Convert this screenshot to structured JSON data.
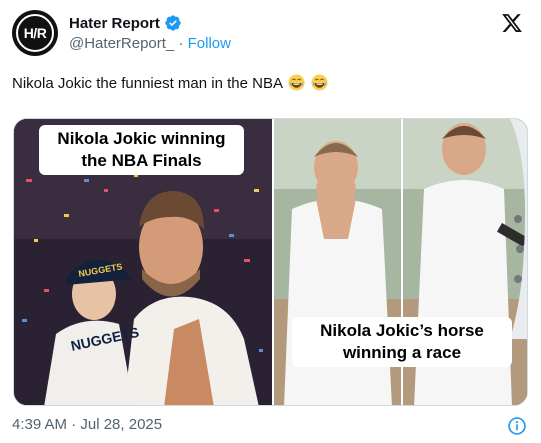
{
  "author": {
    "display_name": "Hater Report",
    "handle": "@HaterReport_",
    "separator": "·",
    "follow_label": "Follow",
    "avatar_text": "H/R"
  },
  "tweet": {
    "text": "Nikola Jokic the funniest man in the NBA",
    "emojis": [
      "laughing-emoji",
      "laughing-emoji"
    ]
  },
  "media": {
    "left_caption": "Nikola Jokic winning the NBA Finals",
    "right_caption": "Nikola Jokic’s horse winning a race"
  },
  "footer": {
    "timestamp": "4:39 AM · Jul 28, 2025"
  },
  "colors": {
    "accent": "#1d9bf0",
    "muted": "#536471",
    "text": "#0f1419"
  },
  "icons": [
    "verified-badge-icon",
    "x-logo-icon",
    "info-icon"
  ]
}
